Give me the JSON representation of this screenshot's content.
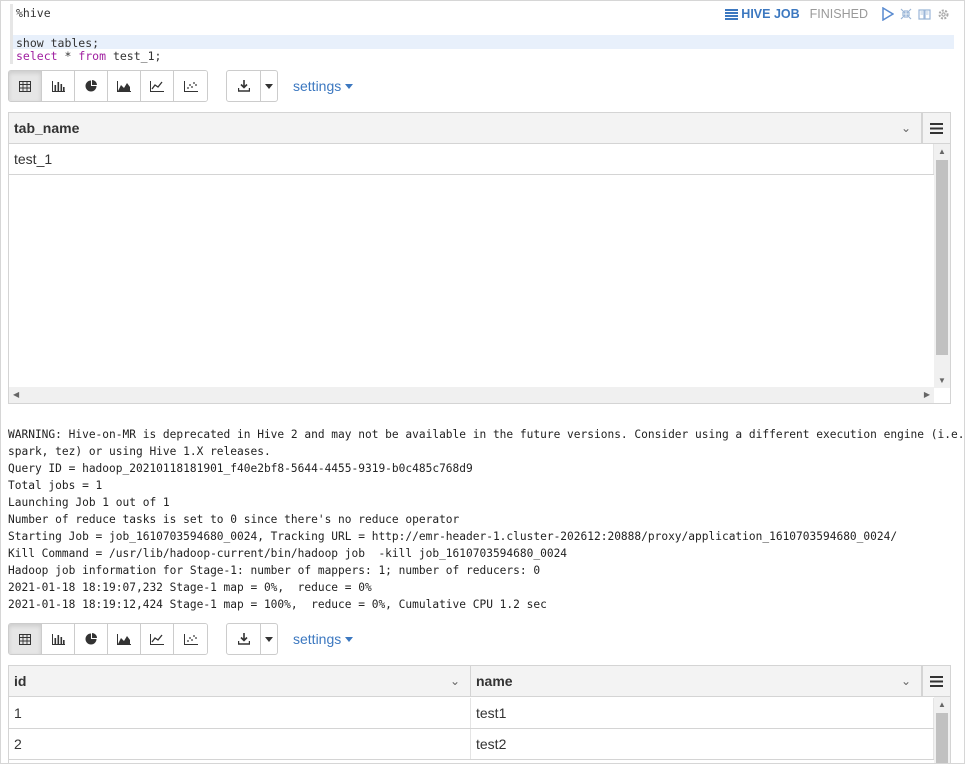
{
  "editor": {
    "lines": [
      {
        "plain": "%hive",
        "kw": "",
        "rest": ""
      },
      {
        "plain": "",
        "kw": "",
        "rest": ""
      },
      {
        "plain": "show tables;",
        "kw": "",
        "rest": ""
      },
      {
        "plain": "",
        "kw1": "select",
        "mid": " * ",
        "kw2": "from",
        "rest": " test_1;"
      }
    ]
  },
  "paragraph": {
    "job_label": "HIVE JOB",
    "status": "FINISHED",
    "icons": [
      "job-list-icon",
      "run-icon",
      "collapse-icon",
      "book-icon",
      "gear-icon"
    ]
  },
  "toolbar": {
    "view_buttons": [
      "table-icon",
      "bar-chart-icon",
      "pie-chart-icon",
      "area-chart-icon",
      "line-chart-icon",
      "scatter-chart-icon"
    ],
    "download_icon": "download-icon",
    "settings_label": "settings"
  },
  "table1": {
    "columns": [
      "tab_name"
    ],
    "rows": [
      [
        "test_1"
      ]
    ]
  },
  "log": [
    "WARNING: Hive-on-MR is deprecated in Hive 2 and may not be available in the future versions. Consider using a different execution engine (i.e.",
    "spark, tez) or using Hive 1.X releases.",
    "Query ID = hadoop_20210118181901_f40e2bf8-5644-4455-9319-b0c485c768d9",
    "Total jobs = 1",
    "Launching Job 1 out of 1",
    "Number of reduce tasks is set to 0 since there's no reduce operator",
    "Starting Job = job_1610703594680_0024, Tracking URL = http://emr-header-1.cluster-202612:20888/proxy/application_1610703594680_0024/",
    "Kill Command = /usr/lib/hadoop-current/bin/hadoop job  -kill job_1610703594680_0024",
    "Hadoop job information for Stage-1: number of mappers: 1; number of reducers: 0",
    "2021-01-18 18:19:07,232 Stage-1 map = 0%,  reduce = 0%",
    "2021-01-18 18:19:12,424 Stage-1 map = 100%,  reduce = 0%, Cumulative CPU 1.2 sec"
  ],
  "table2": {
    "columns": [
      "id",
      "name"
    ],
    "rows": [
      [
        "1",
        "test1"
      ],
      [
        "2",
        "test2"
      ]
    ]
  },
  "colors": {
    "accent": "#3c78c0",
    "status": "#9a9a9a",
    "keyword": "#a020a0"
  }
}
